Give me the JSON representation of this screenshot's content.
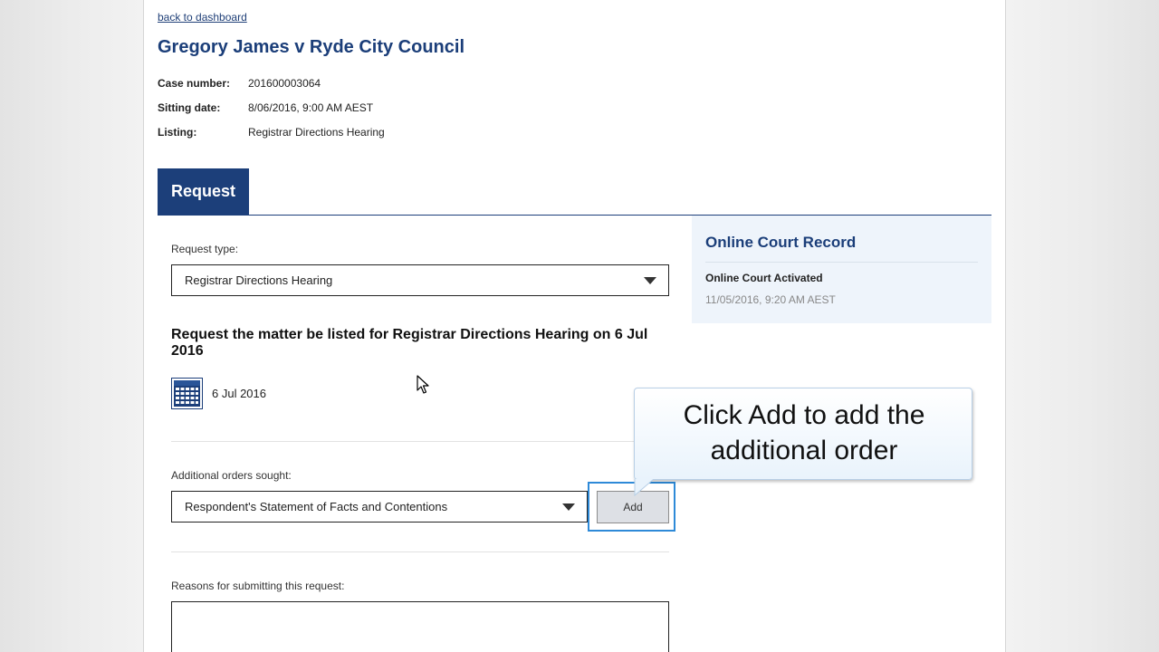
{
  "nav": {
    "back_link": "back to dashboard"
  },
  "case": {
    "title": "Gregory James v Ryde City Council",
    "case_number_label": "Case number:",
    "case_number": "201600003064",
    "sitting_date_label": "Sitting date:",
    "sitting_date": "8/06/2016, 9:00 AM AEST",
    "listing_label": "Listing:",
    "listing": "Registrar Directions Hearing"
  },
  "tabs": {
    "request_label": "Request"
  },
  "form": {
    "request_type_label": "Request type:",
    "request_type_value": "Registrar Directions Hearing",
    "request_heading": "Request the matter be listed for Registrar Directions Hearing on 6 Jul 2016",
    "date_value": "6 Jul 2016",
    "additional_orders_label": "Additional orders sought:",
    "additional_orders_value": "Respondent's Statement of Facts and Contentions",
    "add_button_label": "Add",
    "reasons_label": "Reasons for submitting this request:",
    "reasons_value": ""
  },
  "sidebar": {
    "title": "Online Court Record",
    "status": "Online Court Activated",
    "timestamp": "11/05/2016, 9:20 AM AEST"
  },
  "callout": {
    "text_line1": "Click Add to add the",
    "text_line2": "additional order"
  },
  "colors": {
    "brand_navy": "#1c3f7a",
    "highlight_blue": "#2e8ad8",
    "sidebar_bg": "#eef4fb"
  },
  "icons": {
    "calendar": "calendar-icon",
    "dropdown": "chevron-down-icon",
    "cursor": "mouse-pointer-icon"
  }
}
